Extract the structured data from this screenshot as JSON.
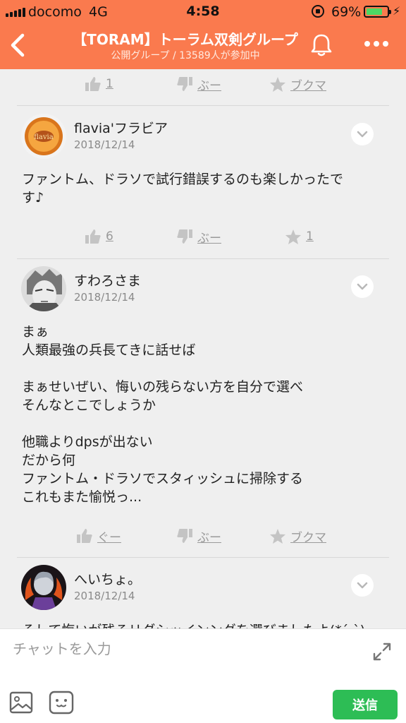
{
  "status_bar": {
    "carrier": "docomo",
    "network": "4G",
    "time": "4:58",
    "battery_percent": "69%",
    "battery_level": 0.69
  },
  "header": {
    "title": "【TORAM】トーラム双剣グループ",
    "subtitle": "公開グループ / 13589人が参加中",
    "back_icon": "chevron-left-icon",
    "bell_icon": "bell-icon",
    "more_icon": "more-dots-icon"
  },
  "top_actions": {
    "like_count": "1",
    "dislike_label": "ぶー",
    "bookmark_label": "ブクマ"
  },
  "posts": [
    {
      "user": "flavia'フラビア",
      "date": "2018/12/14",
      "body": [
        "ファントム、ドラソで試行錯誤するのも楽しかったで",
        "す♪"
      ],
      "actions": {
        "like": "6",
        "dislike": "ぶー",
        "bookmark": "1"
      }
    },
    {
      "user": "すわろさま",
      "date": "2018/12/14",
      "body": [
        "まぁ",
        "人類最強の兵長てきに話せば",
        "",
        "まぁせいぜい、悔いの残らない方を自分で選べ",
        "そんなとこでしょうか",
        "",
        "他職よりdpsが出ない",
        "だから何",
        "ファントム・ドラソでスタィッシュに掃除する",
        "これもまた愉悦っ..."
      ],
      "actions": {
        "like": "ぐー",
        "dislike": "ぶー",
        "bookmark": "ブクマ"
      }
    },
    {
      "user": "へいちょ。",
      "date": "2018/12/14",
      "body": [
        "そして悔いが残るリダシッインングを選びましたよ(*´-`)"
      ]
    }
  ],
  "composer": {
    "placeholder": "チャットを入力",
    "send_label": "送信",
    "send_color": "#2dbd55"
  },
  "colors": {
    "accent": "#fa7a4e",
    "background": "#efefef"
  }
}
